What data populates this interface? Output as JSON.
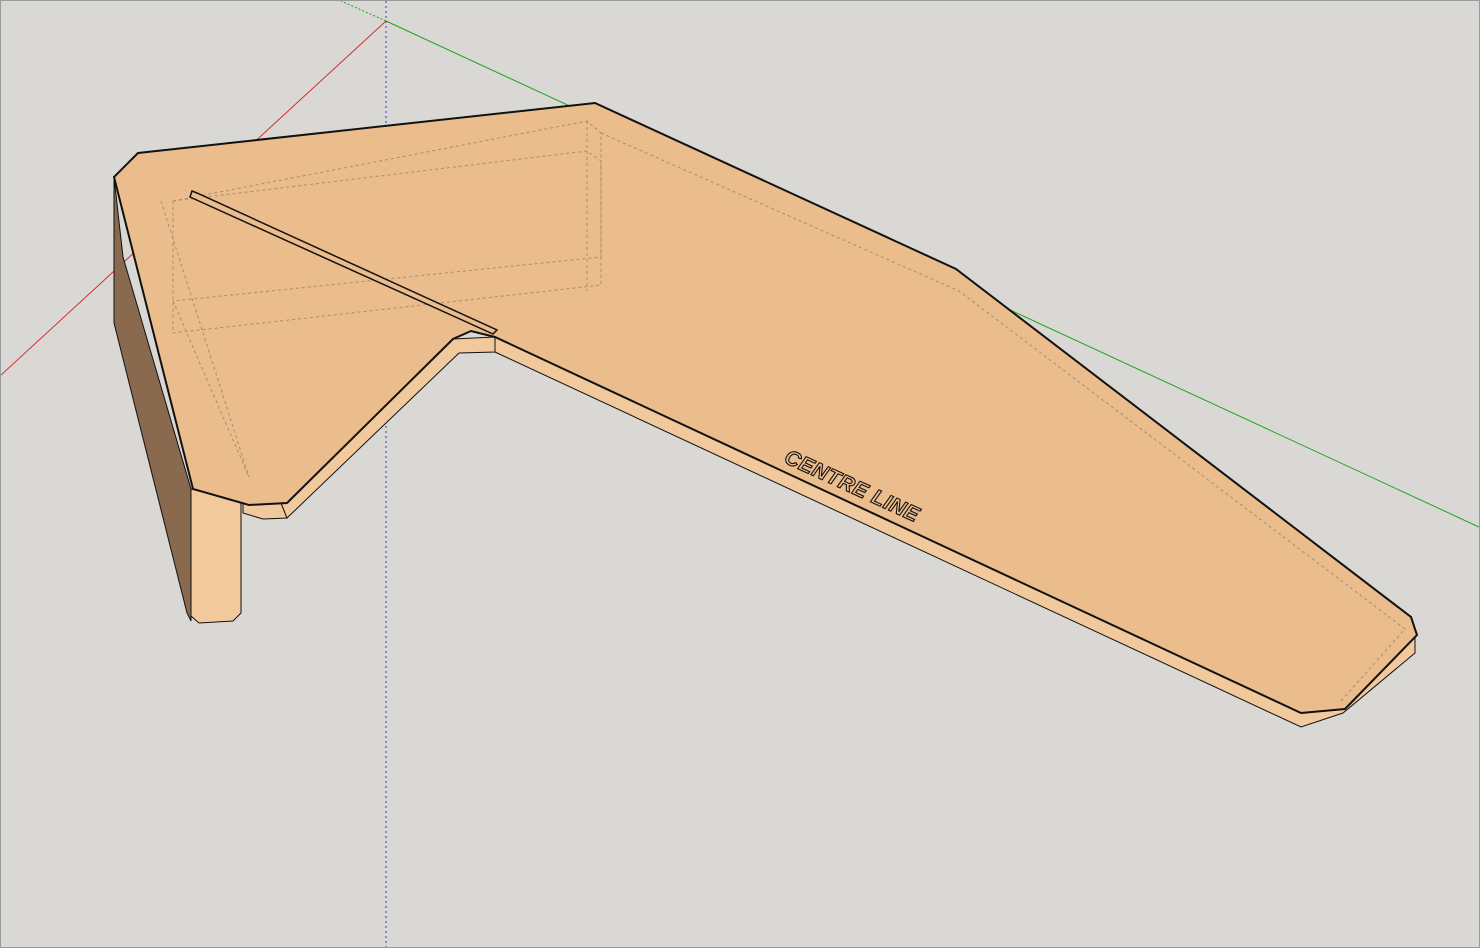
{
  "viewport": {
    "background_color": "#d9d8d4",
    "model_top_color": "#ebbc8c",
    "model_side_light_color": "#f2c89d",
    "model_side_dark_color": "#8a6a4f",
    "edge_color": "#111111",
    "hidden_edge_color": "#a88d70"
  },
  "axes": {
    "x_axis_color": "#d1312f",
    "y_axis_color": "#21a321",
    "z_axis_color": "#3b3bd3"
  },
  "model": {
    "engraved_label": "CENTRE LINE"
  }
}
